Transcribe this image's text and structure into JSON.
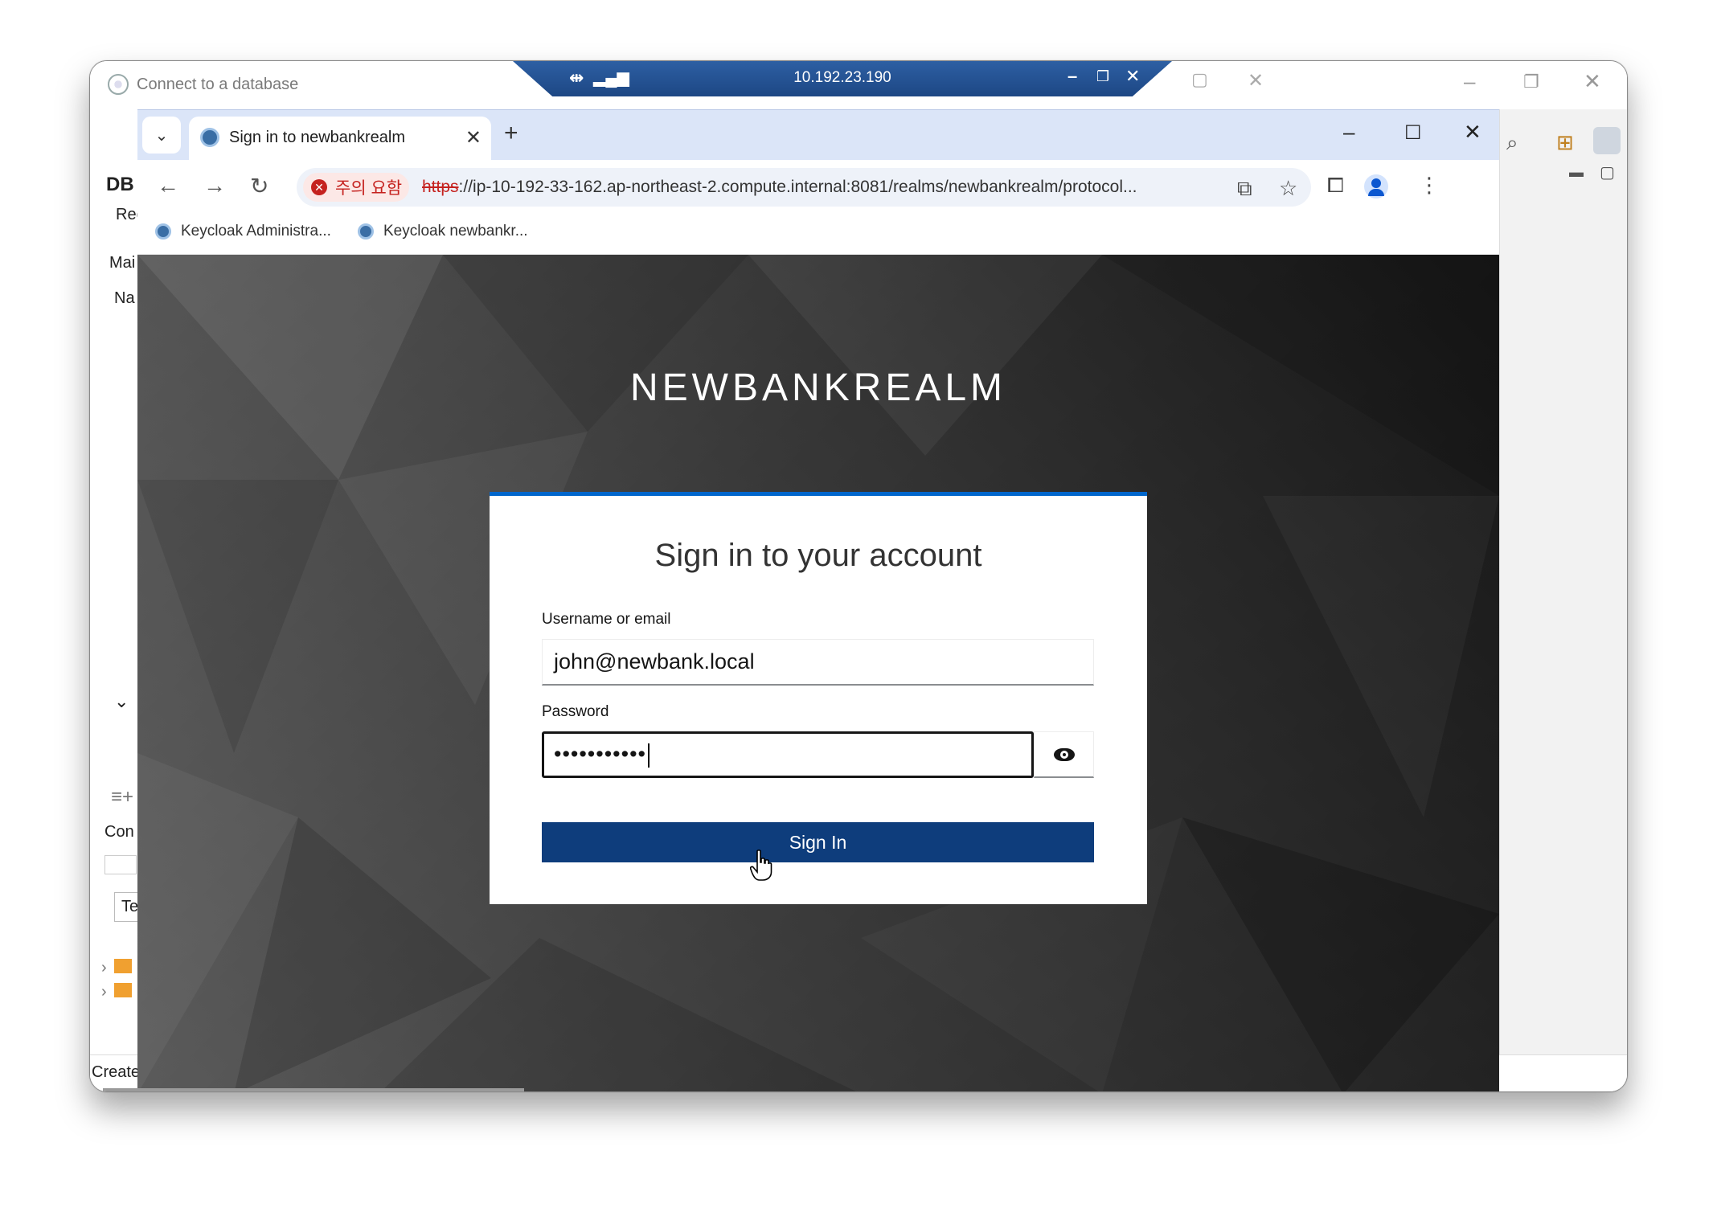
{
  "background_app": {
    "title": "Connect to a database",
    "left_labels": [
      "DB",
      "Rec",
      "Mai",
      "Na",
      "Con",
      "Te"
    ],
    "status_text": "Create"
  },
  "rdp_bar": {
    "host": "10.192.23.190"
  },
  "browser": {
    "tab_title": "Sign in to newbankrealm",
    "security_chip": "주의 요함",
    "url_scheme": "https",
    "url_rest": "://ip-10-192-33-162.ap-northeast-2.compute.internal:8081/realms/newbankrealm/protocol...",
    "bookmarks": [
      "Keycloak Administra...",
      "Keycloak newbankr..."
    ]
  },
  "page": {
    "realm_name": "NEWBANKREALM",
    "card_title": "Sign in to your account",
    "username_label": "Username or email",
    "username_value": "john@newbank.local",
    "password_label": "Password",
    "password_mask": "•••••••••••",
    "signin_label": "Sign In"
  },
  "colors": {
    "accent_blue": "#0066cc",
    "button_blue": "#0e3d7c",
    "rdp_blue": "#1d4784",
    "security_red": "#c5221f"
  },
  "icons": [
    "app-icon",
    "pin-icon",
    "signal-icon",
    "tab-list-icon",
    "favicon-keycloak",
    "close-icon",
    "plus-icon",
    "back-arrow-icon",
    "forward-arrow-icon",
    "reload-icon",
    "error-icon",
    "translate-icon",
    "star-icon",
    "extensions-icon",
    "profile-icon",
    "kebab-menu-icon",
    "eye-icon",
    "hand-cursor-icon"
  ]
}
